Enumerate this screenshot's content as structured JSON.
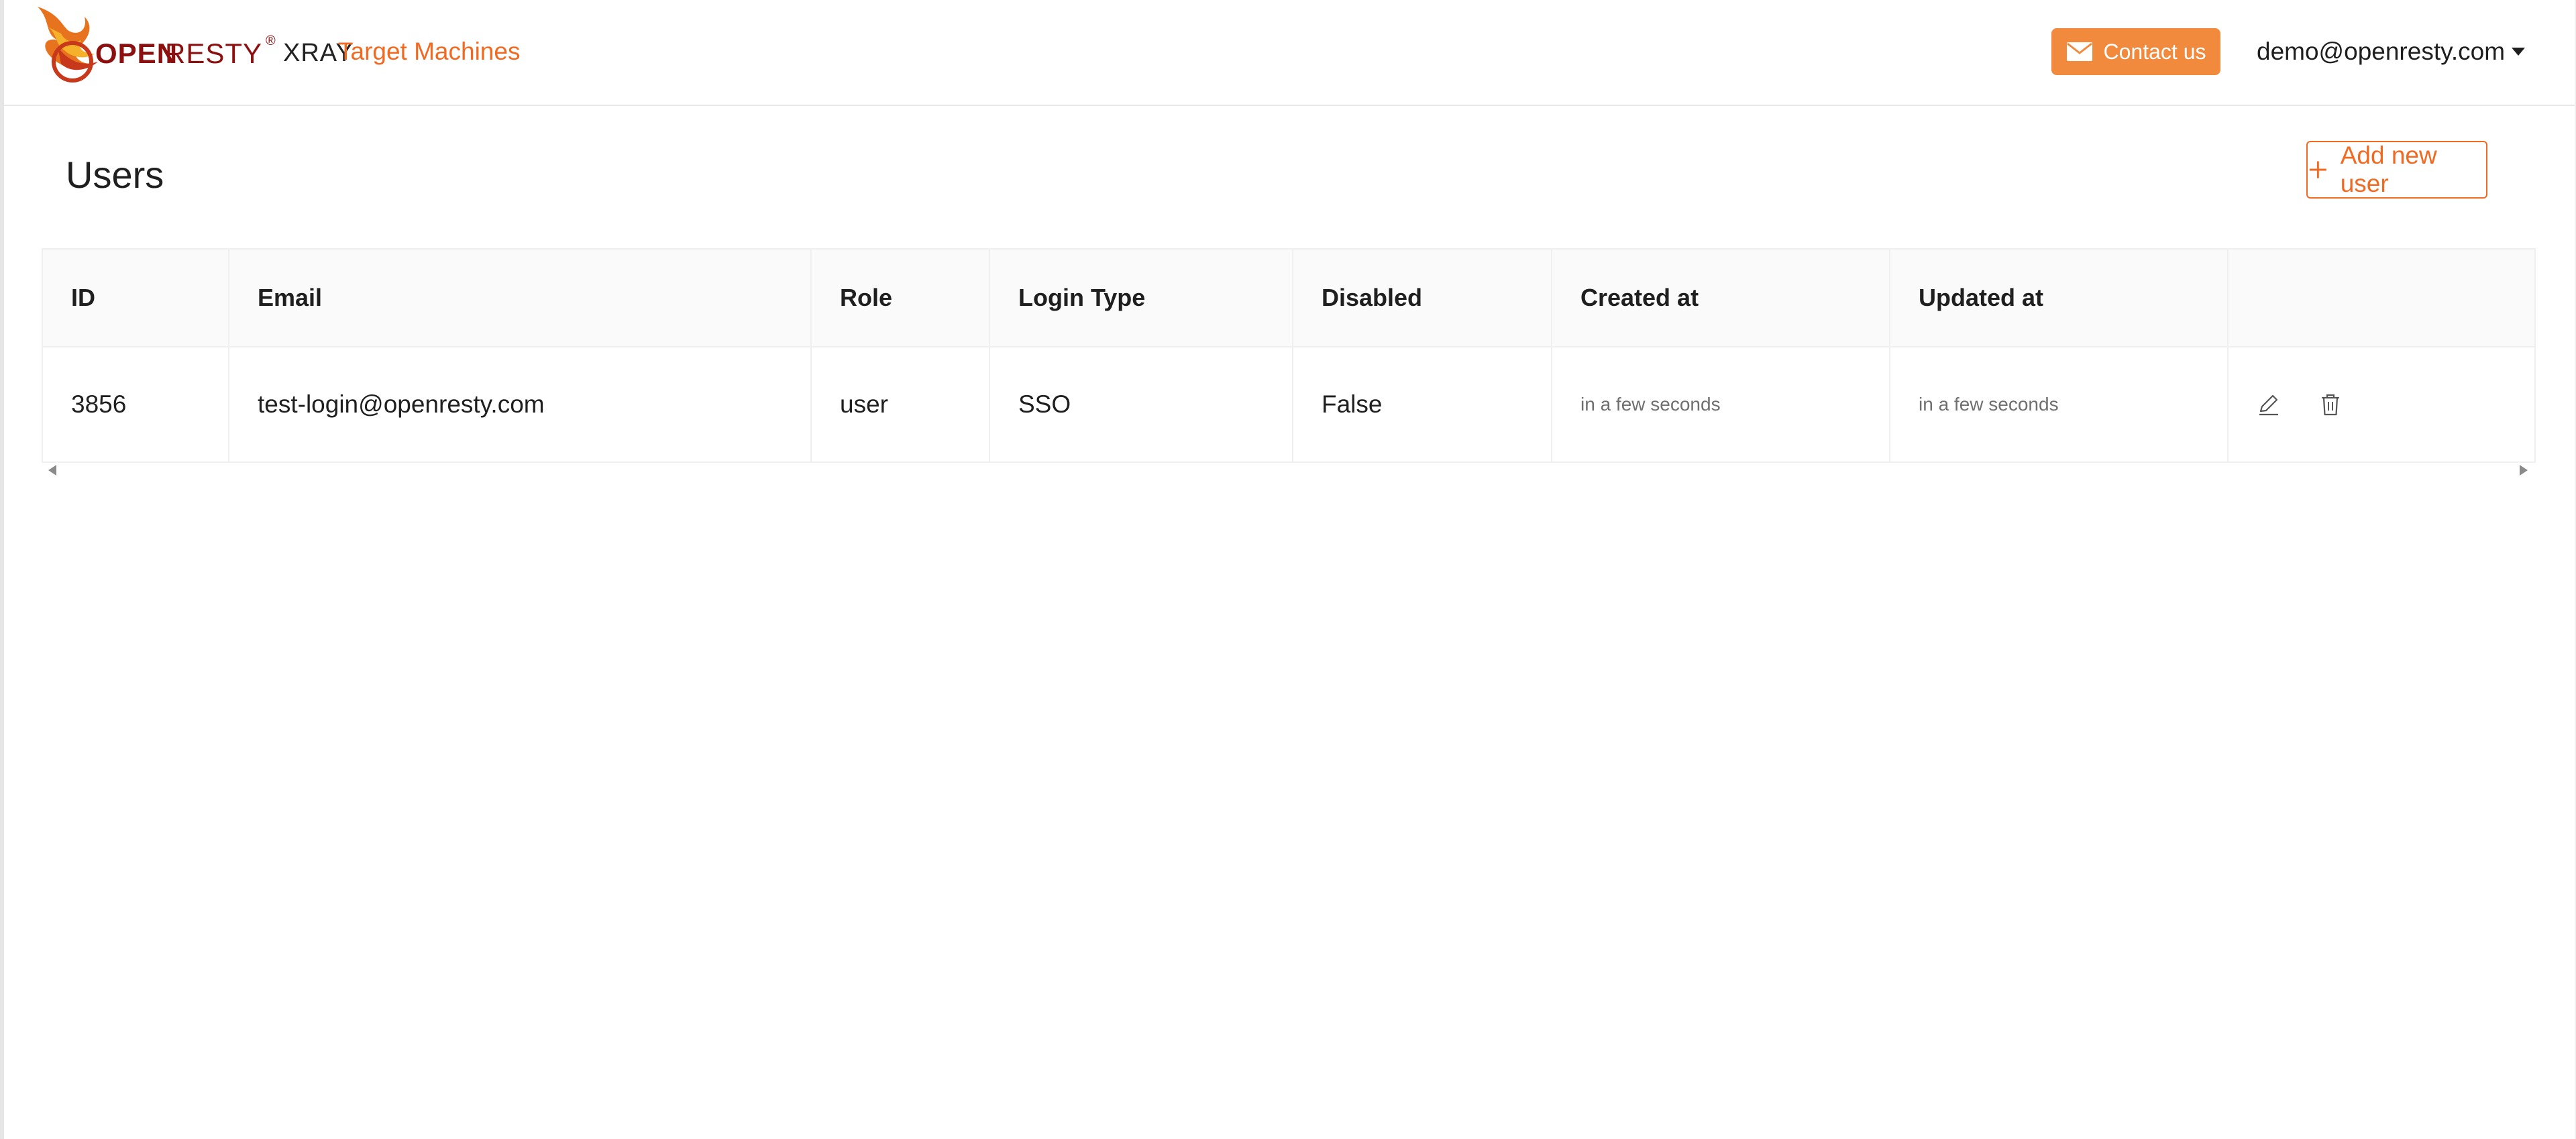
{
  "header": {
    "logo_open": "OPEN",
    "logo_resty": "RESTY",
    "logo_registered": "®",
    "logo_xray": "XRAY",
    "nav_link": "Target Machines",
    "contact_label": "Contact us",
    "user_email": "demo@openresty.com"
  },
  "page": {
    "title": "Users",
    "add_button_label": "Add new user"
  },
  "table": {
    "columns": [
      "ID",
      "Email",
      "Role",
      "Login Type",
      "Disabled",
      "Created at",
      "Updated at",
      ""
    ],
    "rows": [
      {
        "id": "3856",
        "email": "test-login@openresty.com",
        "role": "user",
        "login_type": "SSO",
        "disabled": "False",
        "created_at": "in a few seconds",
        "updated_at": "in a few seconds"
      }
    ]
  },
  "icons": {
    "contact": "mail-icon",
    "add": "plus-icon",
    "edit": "edit-icon",
    "delete": "trash-icon",
    "user_menu": "caret-down-icon"
  },
  "colors": {
    "accent": "#f16a21",
    "contact_button": "#f18a3d",
    "logo_text": "#8c1010"
  }
}
